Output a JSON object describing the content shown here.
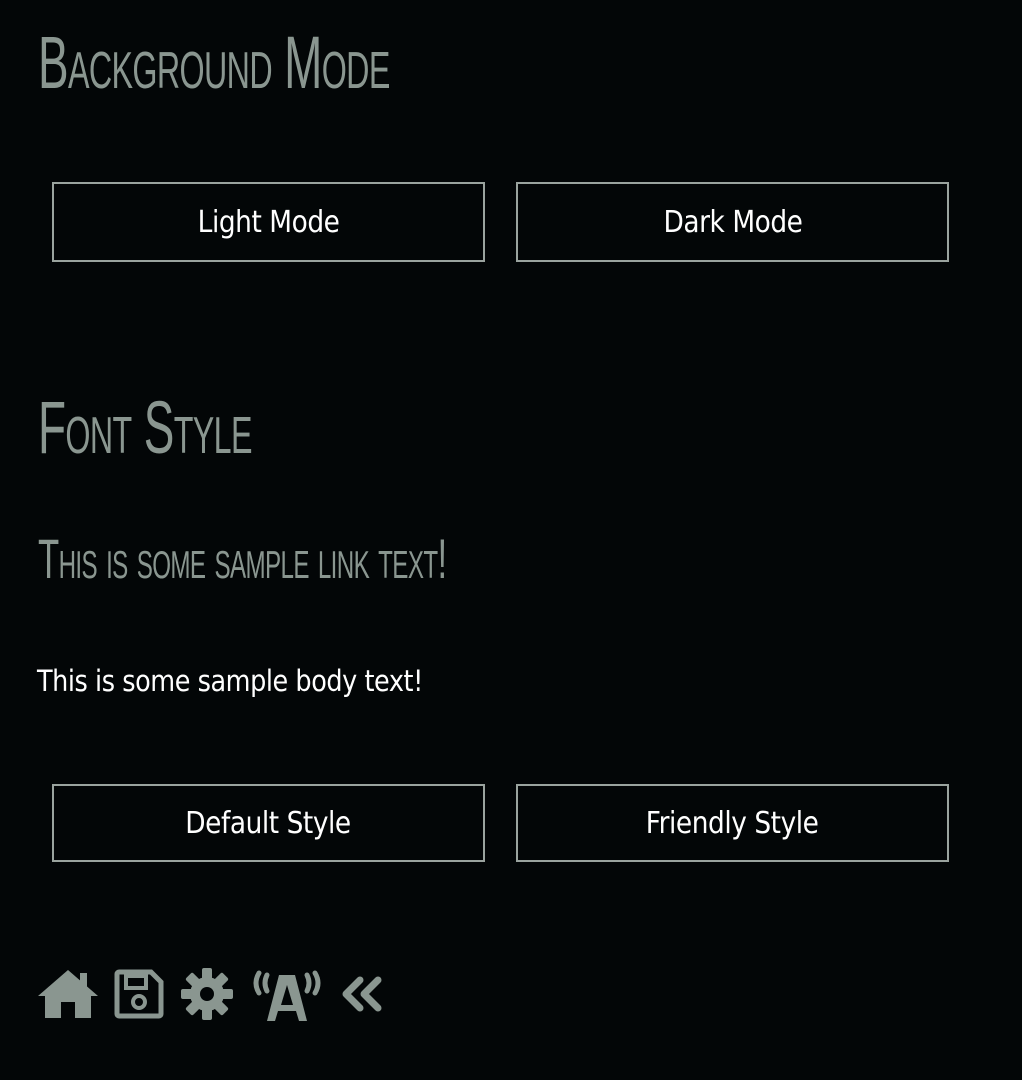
{
  "background_section": {
    "title": "Background Mode",
    "light_button_label": "Light Mode",
    "dark_button_label": "Dark Mode"
  },
  "font_section": {
    "title": "Font Style",
    "link_sample": "This is some sample link text!",
    "body_sample": "This is some sample body text!",
    "default_button_label": "Default Style",
    "friendly_button_label": "Friendly Style"
  },
  "toolbar": {
    "icons": [
      "home-icon",
      "save-icon",
      "gear-icon",
      "radio-tower-icon",
      "double-chevron-left-icon"
    ]
  },
  "colors": {
    "background": "#030607",
    "heading": "#8a9690",
    "button_border": "#9aa39e",
    "text": "#ffffff"
  }
}
